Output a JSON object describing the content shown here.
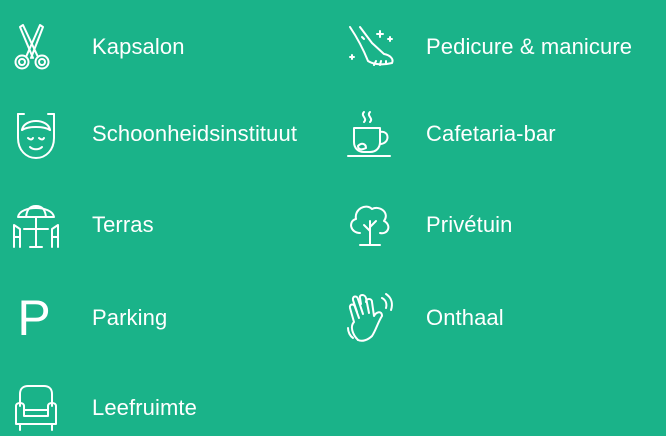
{
  "colors": {
    "background": "#1ab389",
    "foreground": "#ffffff"
  },
  "facilities": [
    {
      "label": "Kapsalon",
      "icon": "scissors-icon"
    },
    {
      "label": "Pedicure & manicure",
      "icon": "foot-care-icon"
    },
    {
      "label": "Schoonheidsinstituut",
      "icon": "face-mask-icon"
    },
    {
      "label": "Cafetaria-bar",
      "icon": "coffee-cup-icon"
    },
    {
      "label": "Terras",
      "icon": "parasol-table-icon"
    },
    {
      "label": "Privétuin",
      "icon": "tree-icon"
    },
    {
      "label": "Parking",
      "icon": "parking-icon",
      "glyph": "P"
    },
    {
      "label": "Onthaal",
      "icon": "waving-hand-icon"
    },
    {
      "label": "Leefruimte",
      "icon": "armchair-icon"
    }
  ]
}
